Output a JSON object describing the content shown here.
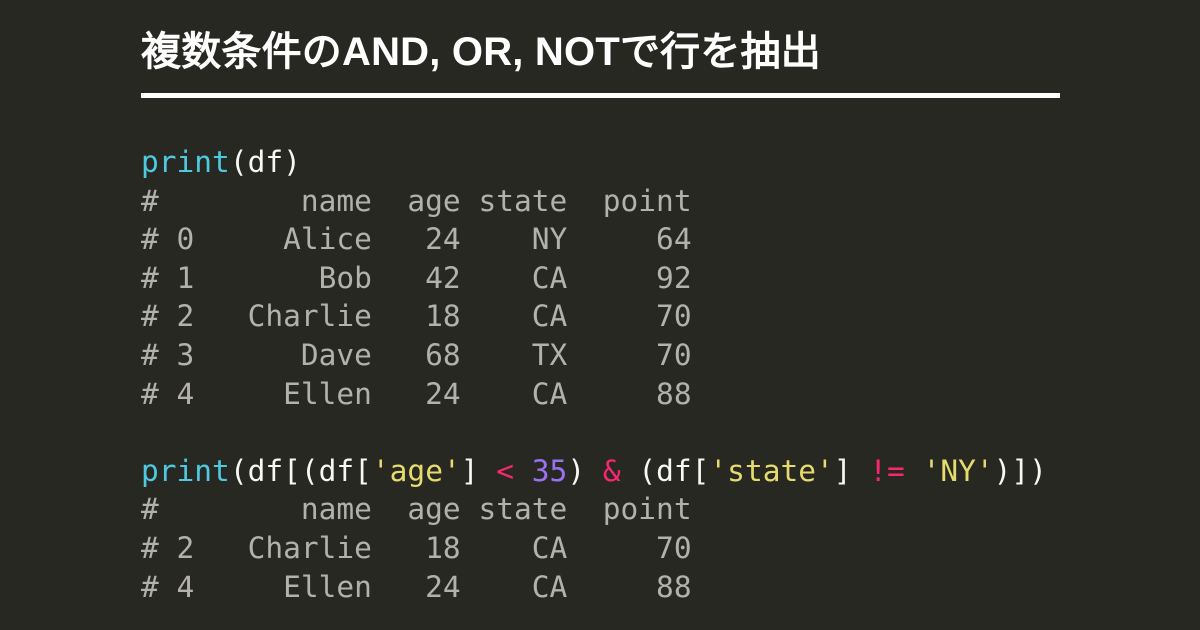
{
  "page": {
    "background_color": "#282823",
    "title": "複数条件のAND, OR, NOTで行を抽出",
    "rule_color": "#ffffff"
  },
  "colors": {
    "function": "#4ec9e0",
    "plain": "#f8f8f2",
    "string": "#e6db6e",
    "operator": "#f92672",
    "number": "#9a72f0",
    "comment": "#b2b2ab"
  },
  "code_blocks": [
    {
      "name": "print-df-block",
      "statement": {
        "tokens": [
          {
            "text": "print",
            "type": "function"
          },
          {
            "text": "(df)",
            "type": "plain"
          }
        ]
      },
      "output": [
        "#        name  age state  point",
        "# 0     Alice   24    NY     64",
        "# 1       Bob   42    CA     92",
        "# 2   Charlie   18    CA     70",
        "# 3      Dave   68    TX     70",
        "# 4     Ellen   24    CA     88"
      ]
    },
    {
      "name": "print-filtered-block",
      "statement": {
        "tokens": [
          {
            "text": "print",
            "type": "function"
          },
          {
            "text": "(df[(df[",
            "type": "plain"
          },
          {
            "text": "'age'",
            "type": "string"
          },
          {
            "text": "] ",
            "type": "plain"
          },
          {
            "text": "<",
            "type": "operator"
          },
          {
            "text": " ",
            "type": "plain"
          },
          {
            "text": "35",
            "type": "number"
          },
          {
            "text": ") ",
            "type": "plain"
          },
          {
            "text": "&",
            "type": "operator"
          },
          {
            "text": " (df[",
            "type": "plain"
          },
          {
            "text": "'state'",
            "type": "string"
          },
          {
            "text": "] ",
            "type": "plain"
          },
          {
            "text": "!=",
            "type": "operator"
          },
          {
            "text": " ",
            "type": "plain"
          },
          {
            "text": "'NY'",
            "type": "string"
          },
          {
            "text": ")])",
            "type": "plain"
          }
        ]
      },
      "output": [
        "#        name  age state  point",
        "# 2   Charlie   18    CA     70",
        "# 4     Ellen   24    CA     88"
      ]
    }
  ],
  "dataframe": {
    "columns": [
      "name",
      "age",
      "state",
      "point"
    ],
    "index": [
      0,
      1,
      2,
      3,
      4
    ],
    "rows": [
      {
        "index": 0,
        "name": "Alice",
        "age": 24,
        "state": "NY",
        "point": 64
      },
      {
        "index": 1,
        "name": "Bob",
        "age": 42,
        "state": "CA",
        "point": 92
      },
      {
        "index": 2,
        "name": "Charlie",
        "age": 18,
        "state": "CA",
        "point": 70
      },
      {
        "index": 3,
        "name": "Dave",
        "age": 68,
        "state": "TX",
        "point": 70
      },
      {
        "index": 4,
        "name": "Ellen",
        "age": 24,
        "state": "CA",
        "point": 88
      }
    ],
    "filtered_rows": [
      {
        "index": 2,
        "name": "Charlie",
        "age": 18,
        "state": "CA",
        "point": 70
      },
      {
        "index": 4,
        "name": "Ellen",
        "age": 24,
        "state": "CA",
        "point": 88
      }
    ]
  }
}
